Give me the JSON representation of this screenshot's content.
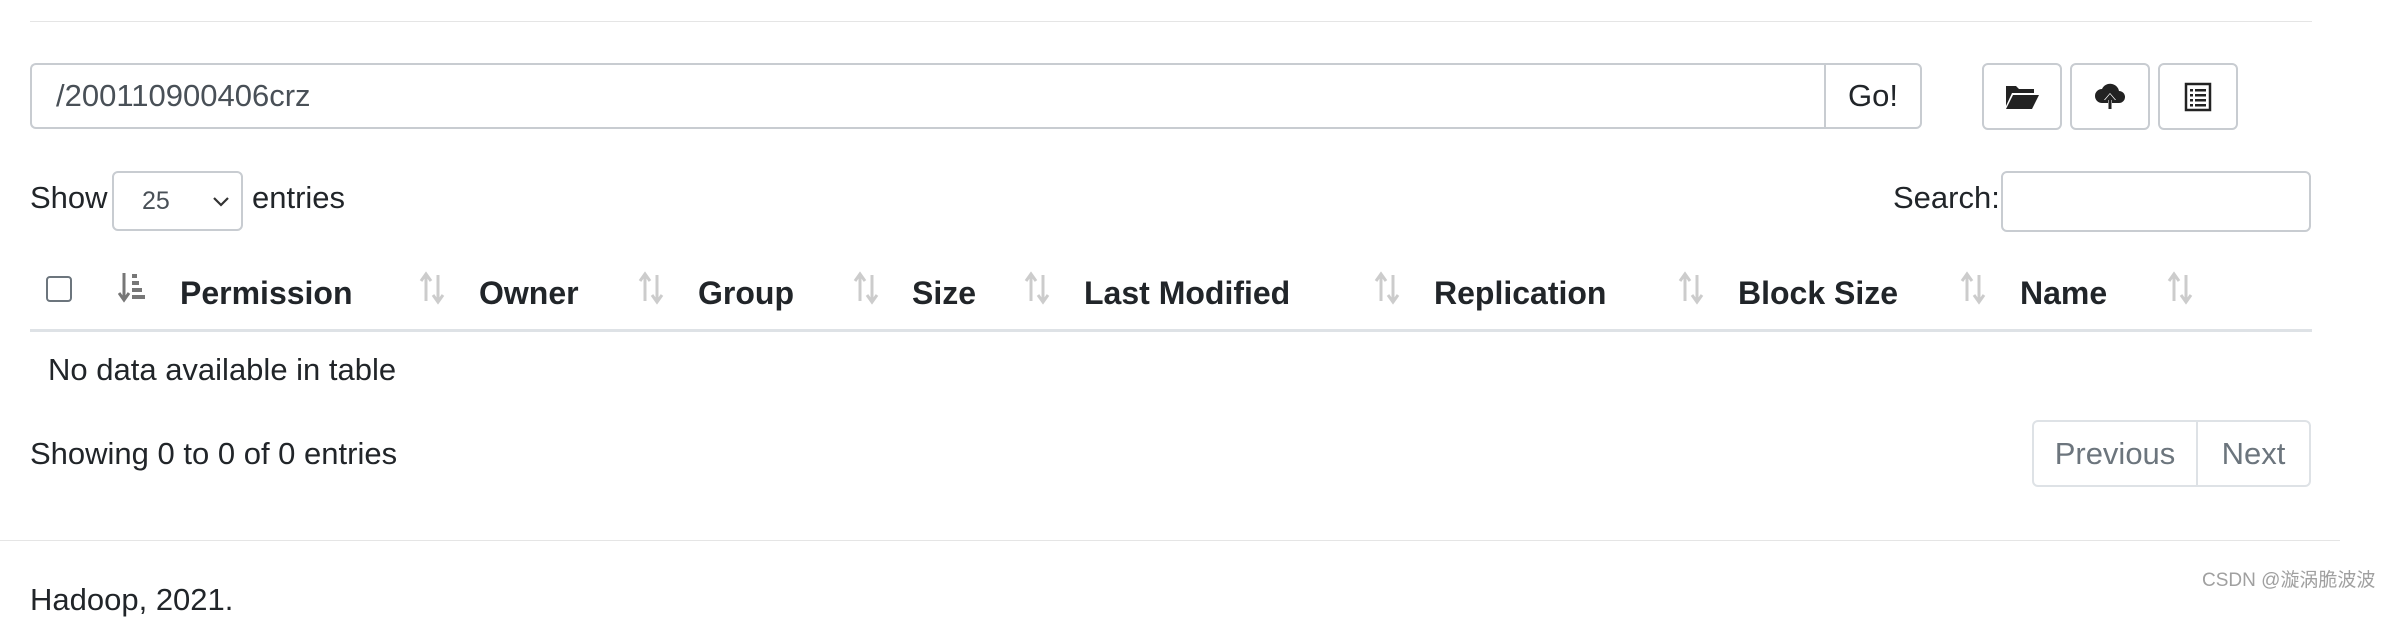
{
  "path_bar": {
    "value": "/200110900406crz",
    "go_label": "Go!"
  },
  "toolbar": {
    "buttons": [
      {
        "icon": "folder-open-icon"
      },
      {
        "icon": "cloud-upload-icon"
      },
      {
        "icon": "list-alt-icon"
      }
    ]
  },
  "length": {
    "show_label": "Show",
    "selected": "25",
    "entries_label": "entries"
  },
  "search": {
    "label": "Search:",
    "value": ""
  },
  "table": {
    "columns": [
      "Permission",
      "Owner",
      "Group",
      "Size",
      "Last Modified",
      "Replication",
      "Block Size",
      "Name"
    ],
    "empty_message": "No data available in table"
  },
  "info": {
    "text": "Showing 0 to 0 of 0 entries"
  },
  "pagination": {
    "previous": "Previous",
    "next": "Next"
  },
  "footer": {
    "text": "Hadoop, 2021."
  },
  "watermark": "CSDN @漩涡脆波波",
  "colors": {
    "border": "#c8ccd1",
    "text": "#212529",
    "muted": "#6c757d"
  }
}
